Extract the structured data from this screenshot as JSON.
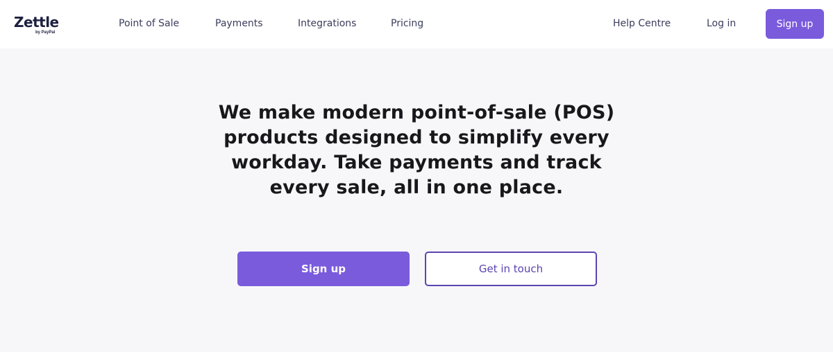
{
  "brand": {
    "logo_text": "Zettle",
    "logo_subtext": "by PayPal",
    "accent_color": "#7a5bdc"
  },
  "nav": {
    "items": [
      {
        "label": "Point of Sale"
      },
      {
        "label": "Payments"
      },
      {
        "label": "Integrations"
      },
      {
        "label": "Pricing"
      }
    ]
  },
  "utility": {
    "help_label": "Help Centre",
    "login_label": "Log in",
    "signup_label": "Sign up"
  },
  "hero": {
    "headline": "We make modern point-of-sale (POS) products designed to simplify every workday. Take payments and track every sale, all in one place.",
    "primary_cta": "Sign up",
    "secondary_cta": "Get in touch"
  }
}
